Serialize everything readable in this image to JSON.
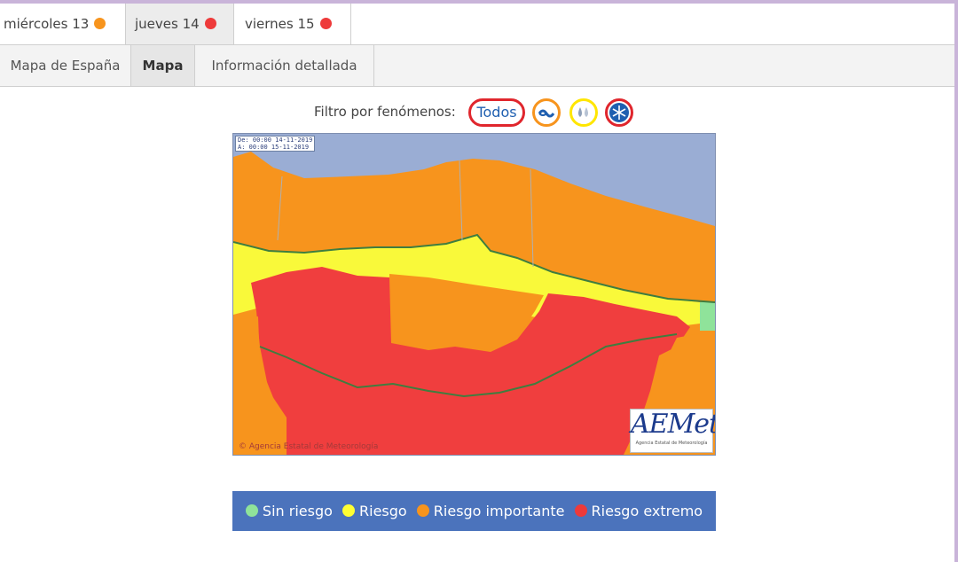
{
  "day_tabs": [
    {
      "label": "miércoles 13",
      "dot_color": "#f7941d"
    },
    {
      "label": "jueves 14",
      "dot_color": "#ee3a3a",
      "active": true
    },
    {
      "label": "viernes 15",
      "dot_color": "#ee3a3a"
    }
  ],
  "view_tabs": [
    {
      "label": "Mapa de España"
    },
    {
      "label": "Mapa",
      "active": true
    },
    {
      "label": "Información detallada"
    }
  ],
  "filter": {
    "label": "Filtro por fenómenos:",
    "all_label": "Todos",
    "phenomena": [
      {
        "icon": "wind-waves-icon",
        "border_color": "#f7941d"
      },
      {
        "icon": "rain-icon",
        "border_color": "#ffe600"
      },
      {
        "icon": "snowflake-icon",
        "border_color": "#e0262d"
      }
    ]
  },
  "map": {
    "valid_from": "De: 00:00 14-11-2019",
    "valid_to": "A:  00:00 15-11-2019",
    "copyright": "© Agencia Estatal de Meteorología",
    "logo_text": "AEMet",
    "logo_subtext": "Agencia Estatal de Meteorología"
  },
  "legend": [
    {
      "label": "Sin riesgo",
      "color": "#8fe39a"
    },
    {
      "label": "Riesgo",
      "color": "#ffff33"
    },
    {
      "label": "Riesgo importante",
      "color": "#f7941d"
    },
    {
      "label": "Riesgo extremo",
      "color": "#ee3a3a"
    }
  ],
  "colors": {
    "sea": "#9aadd4",
    "none": "#8fe39a",
    "yellow": "#f9f93a",
    "orange": "#f7941d",
    "red": "#f03e3e",
    "legend_bg": "#4b73bc"
  }
}
